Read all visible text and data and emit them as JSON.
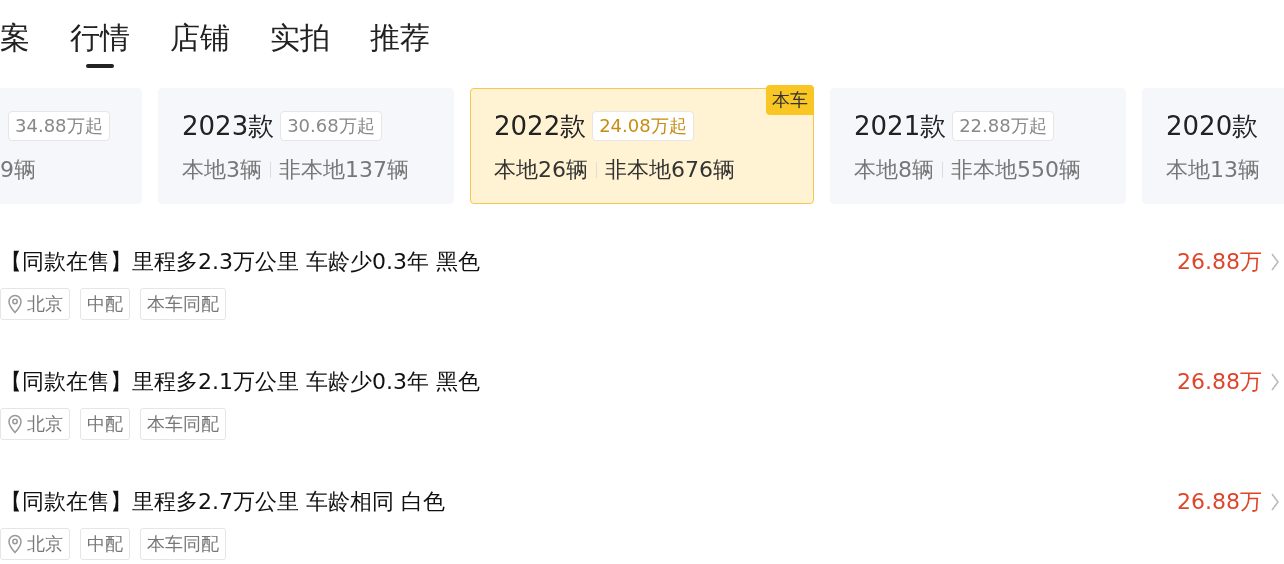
{
  "tabs": [
    {
      "label": "案",
      "selected": false
    },
    {
      "label": "行情",
      "selected": true
    },
    {
      "label": "店铺",
      "selected": false
    },
    {
      "label": "实拍",
      "selected": false
    },
    {
      "label": "推荐",
      "selected": false
    }
  ],
  "model_cards": [
    {
      "kind": "partial",
      "price": "34.88万起",
      "local": "9辆",
      "selected": false
    },
    {
      "kind": "full",
      "year": "2023款",
      "price": "30.68万起",
      "local": "本地3辆",
      "nonlocal": "非本地137辆",
      "selected": false
    },
    {
      "kind": "full",
      "year": "2022款",
      "price": "24.08万起",
      "local": "本地26辆",
      "nonlocal": "非本地676辆",
      "selected": true,
      "badge": "本车"
    },
    {
      "kind": "full",
      "year": "2021款",
      "price": "22.88万起",
      "local": "本地8辆",
      "nonlocal": "非本地550辆",
      "selected": false
    },
    {
      "kind": "cut",
      "year": "2020款",
      "local": "本地13辆",
      "selected": false
    }
  ],
  "listings": [
    {
      "title": "【同款在售】里程多2.3万公里 车龄少0.3年 黑色",
      "location": "北京",
      "tags": [
        "中配",
        "本车同配"
      ],
      "price": "26.88万"
    },
    {
      "title": "【同款在售】里程多2.1万公里 车龄少0.3年 黑色",
      "location": "北京",
      "tags": [
        "中配",
        "本车同配"
      ],
      "price": "26.88万"
    },
    {
      "title": "【同款在售】里程多2.7万公里 车龄相同 白色",
      "location": "北京",
      "tags": [
        "中配",
        "本车同配"
      ],
      "price": "26.88万"
    }
  ]
}
